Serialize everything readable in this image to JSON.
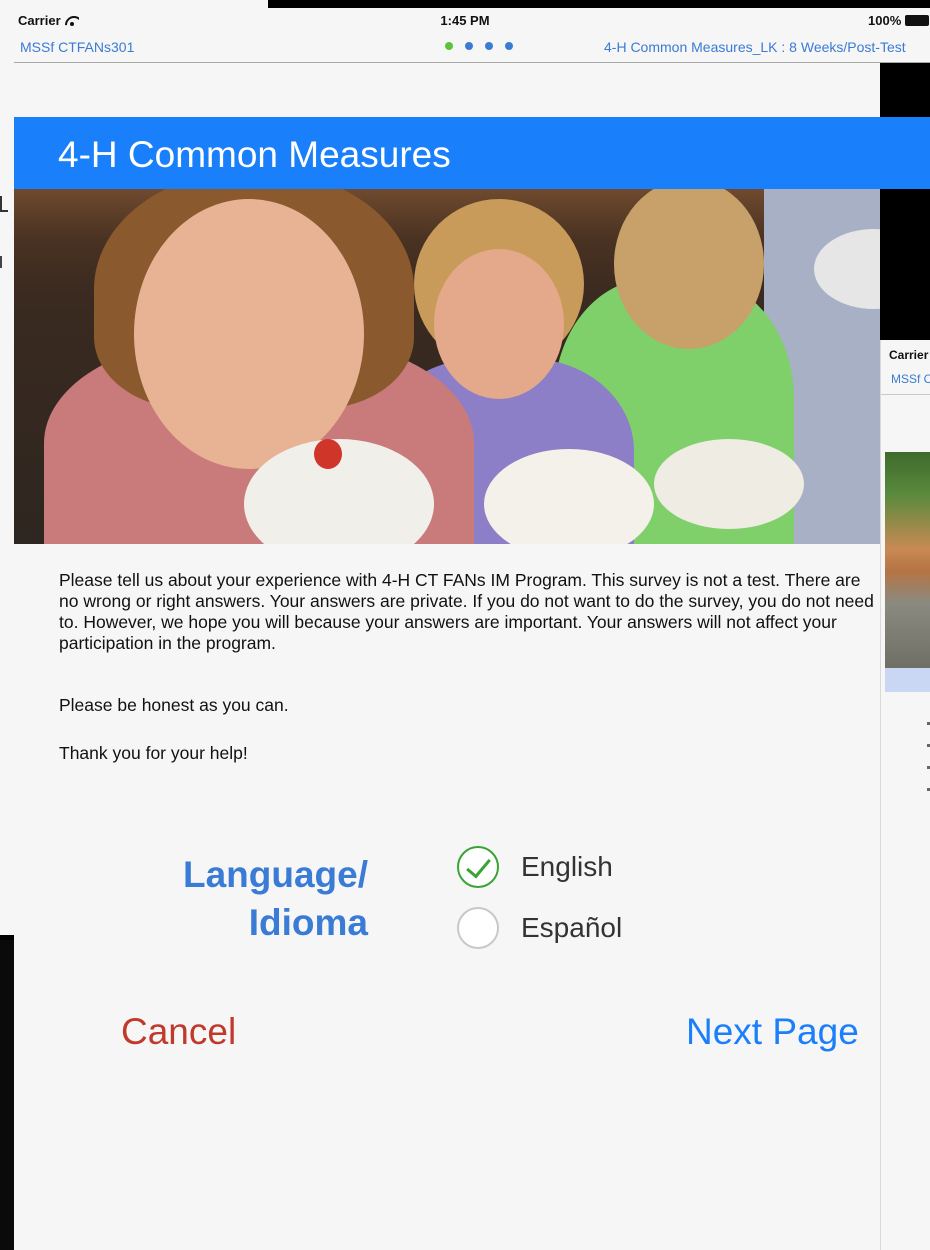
{
  "status_bar": {
    "carrier": "Carrier",
    "time": "1:45 PM",
    "battery": "100%"
  },
  "nav": {
    "left_label": "MSSf CTFANs301",
    "right_label": "4-H Common Measures_LK : 8 Weeks/Post-Test",
    "page_dots": 4,
    "active_dot_index": 0,
    "accent_color": "#3a7bd5",
    "active_dot_color": "#5cc33a"
  },
  "banner": {
    "title": "4-H Common Measures",
    "color": "#1a7ffb"
  },
  "hero": {
    "image": "children-holding-chickens-photo"
  },
  "body": {
    "intro": "Please tell us about your experience with 4-H CT FANs IM Program. This survey is not a test.  There are no wrong or right answers. Your answers are private.  If you do not want to do the survey, you do not need to. However, we hope you will because your answers are important. Your answers will not affect your participation in the program.",
    "honest": "Please be honest as you can.",
    "thanks": "Thank you for your help!"
  },
  "language": {
    "label_line1": "Language/",
    "label_line2": "Idioma",
    "options": [
      {
        "label": "English",
        "selected": true
      },
      {
        "label": "Español",
        "selected": false
      }
    ]
  },
  "actions": {
    "cancel": "Cancel",
    "next": "Next Page",
    "cancel_color": "#c0392b",
    "next_color": "#1a7ffb"
  },
  "background_window": {
    "status": "Carrier",
    "nav": "MSSf C"
  }
}
